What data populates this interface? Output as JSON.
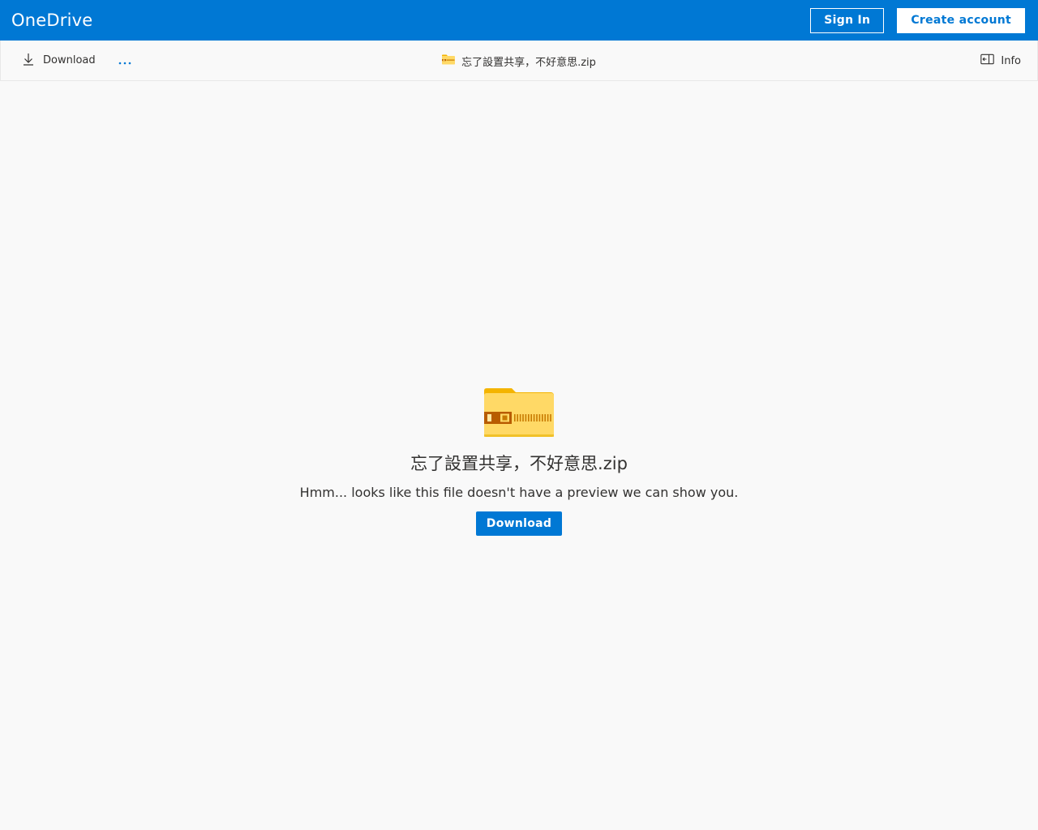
{
  "header": {
    "brand": "OneDrive",
    "sign_in_label": "Sign In",
    "create_account_label": "Create account",
    "colors": {
      "bar": "#0078d4",
      "text": "#ffffff"
    }
  },
  "commandbar": {
    "download_label": "Download",
    "more_label": "···",
    "file_title": "忘了設置共享，不好意思.zip",
    "info_label": "Info",
    "icons": {
      "download": "download-icon",
      "more": "more-options-icon",
      "file": "zip-file-icon",
      "info": "info-pane-icon"
    }
  },
  "preview": {
    "file_name": "忘了設置共享，不好意思.zip",
    "message": "Hmm... looks like this file doesn't have a preview we can show you.",
    "download_label": "Download",
    "icon": "zip-folder-icon"
  }
}
